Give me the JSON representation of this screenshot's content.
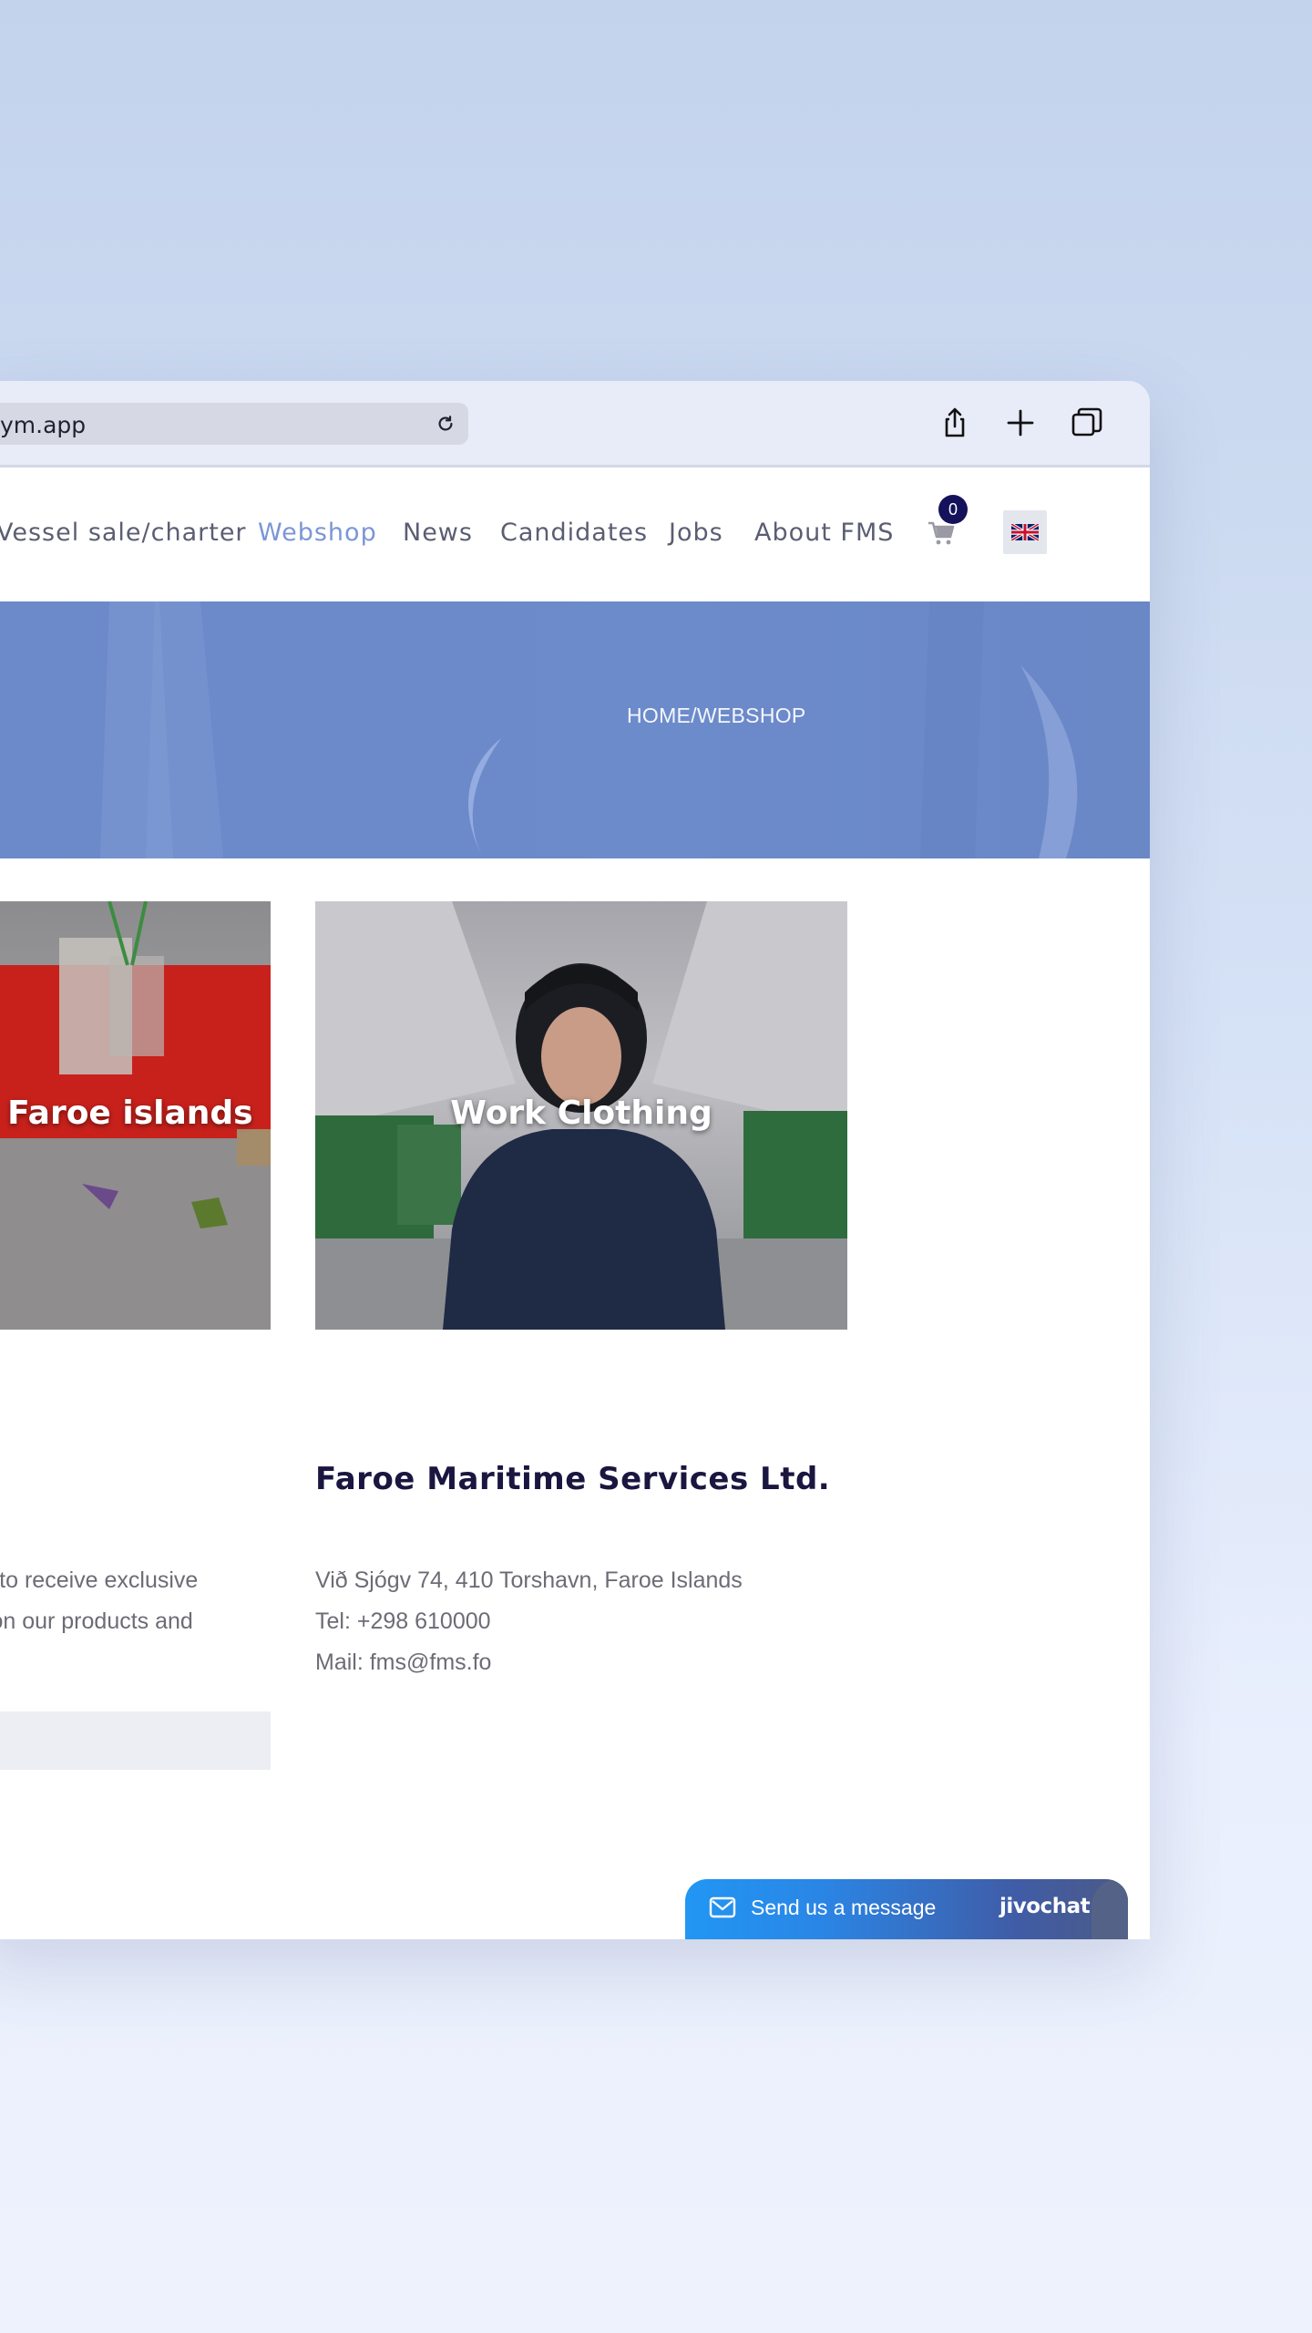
{
  "browser": {
    "url": "ym.app",
    "icons": [
      "reload-icon",
      "share-icon",
      "new-tab-icon",
      "tabs-icon"
    ]
  },
  "nav": {
    "items": [
      {
        "label": "Vessel sale/charter",
        "active": false
      },
      {
        "label": "Webshop",
        "active": true
      },
      {
        "label": "News",
        "active": false
      },
      {
        "label": "Candidates",
        "active": false
      },
      {
        "label": "Jobs",
        "active": false
      },
      {
        "label": "About FMS",
        "active": false
      }
    ],
    "cart_count": "0",
    "language_icon": "uk-flag-icon",
    "accent_color": "#7b96d6"
  },
  "hero": {
    "breadcrumb": "HOME/WEBSHOP"
  },
  "categories": [
    {
      "label": "n Faroe islands"
    },
    {
      "label": "Work Clothing"
    }
  ],
  "newsletter": {
    "lines": [
      "er to receive exclusive",
      "s on our products and"
    ]
  },
  "company": {
    "name": "Faroe Maritime Services Ltd.",
    "address": "Við Sjógv 74, 410 Torshavn, Faroe Islands",
    "tel": "Tel: +298 610000",
    "mail": "Mail: fms@fms.fo"
  },
  "chat": {
    "label": "Send us a message",
    "brand": "jivochat"
  }
}
